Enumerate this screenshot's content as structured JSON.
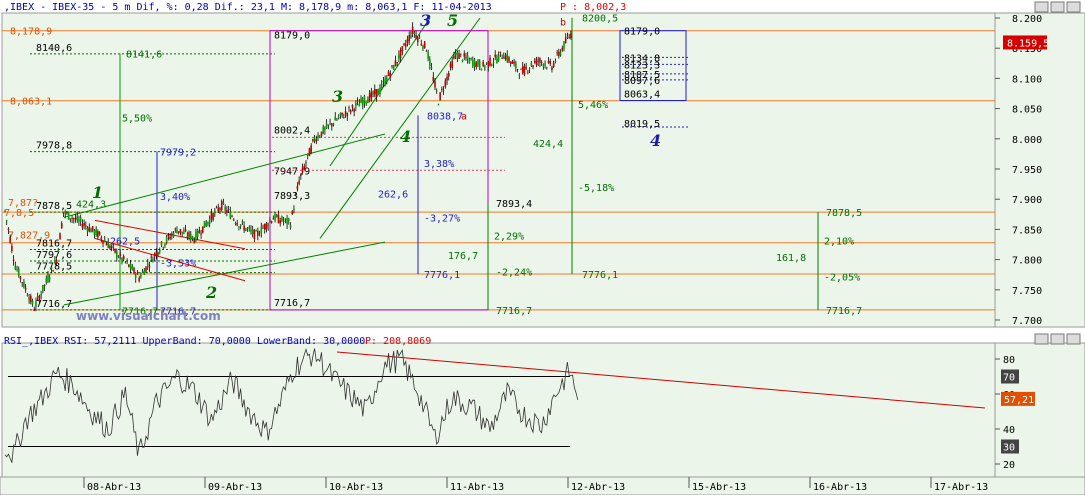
{
  "header": {
    "symbol_line": ",IBEX - IBEX-35 - 5 m Dif, %: 0,28 Dif.: 23,1 M: 8,178,9 m: 8,063,1 F: 11-04-2013",
    "pclose": "P : 8,002,3"
  },
  "rsi_header": {
    "text": "RSI_,IBEX RSI: 57,2111 UpperBand: 70,0000 LowerBand: 30,0000",
    "p": "P: 208,8069"
  },
  "watermark": "www.visualchart.com",
  "price_axis": {
    "ticks": [
      "8.200",
      "8.150",
      "8.100",
      "8.050",
      "8.000",
      "7.950",
      "7.900",
      "7.850",
      "7.800",
      "7.750",
      "7.700"
    ],
    "last_price": "8.159,5",
    "last_price_color": "#d50000"
  },
  "rsi_axis": {
    "ticks": [
      "80",
      "60",
      "40",
      "20"
    ],
    "upper_box": "70",
    "lower_box": "30",
    "current_box": "57,21"
  },
  "date_axis": [
    "08-Abr-13",
    "09-Abr-13",
    "10-Abr-13",
    "11-Abr-13",
    "12-Abr-13",
    "15-Abr-13",
    "16-Abr-13",
    "17-Abr-13"
  ],
  "annotations": {
    "h_left": [
      "8,178,9",
      "8,063,1",
      "7,87?",
      "7,827,9",
      "7,8,5"
    ],
    "box_left": [
      "8140,6",
      "7978,8",
      "7878,5",
      "7816,7",
      "7797,6",
      "7778,5",
      "7716,7"
    ],
    "left_fib": [
      "8141,6",
      "5,50%",
      "7979,2",
      "3,40%",
      "424,3",
      "262,5",
      "-3,53%",
      "7716,7",
      "7716,7"
    ],
    "mid_labels": [
      "8179,0",
      "8002,4",
      "7947,9",
      "7893,3",
      "262,6",
      "7716,7",
      "8038,7",
      "3,38%",
      "-3,27%",
      "7776,1",
      "7893,4",
      "2,29%",
      "176,7",
      "-2,24%",
      "7716,7"
    ],
    "right_labels": [
      "8200,5",
      "b",
      "a",
      "5,46%",
      "424,4",
      "-5,18%",
      "7776,1",
      "8179,0",
      "8134,8",
      "8123,3",
      "8107,5",
      "8097,6",
      "8063,4",
      "8019,5",
      "7878,5",
      "2,10%",
      "161,8",
      "-2,05%",
      "7716,7"
    ],
    "waves": [
      "1",
      "2",
      "3",
      "4",
      "3",
      "5",
      "4"
    ]
  },
  "chart_data": {
    "type": "candlestick",
    "title": "IBEX-35 5 m",
    "price_range": [
      7700,
      8200
    ],
    "rsi_range": [
      15,
      85
    ],
    "key_levels": [
      8178.9,
      8063.1,
      7878.5,
      7827.9,
      7776.1,
      7716.7
    ],
    "price_path": [
      [
        7880,
        0
      ],
      [
        7790,
        6
      ],
      [
        7720,
        17
      ],
      [
        7800,
        30
      ],
      [
        7878,
        34
      ],
      [
        7860,
        45
      ],
      [
        7840,
        55
      ],
      [
        7810,
        65
      ],
      [
        7790,
        72
      ],
      [
        7770,
        78
      ],
      [
        7820,
        90
      ],
      [
        7850,
        100
      ],
      [
        7835,
        110
      ],
      [
        7870,
        120
      ],
      [
        7890,
        126
      ],
      [
        7860,
        136
      ],
      [
        7840,
        146
      ],
      [
        7870,
        156
      ],
      [
        7860,
        166
      ],
      [
        7930,
        171
      ],
      [
        8000,
        180
      ],
      [
        8030,
        192
      ],
      [
        8060,
        207
      ],
      [
        8080,
        218
      ],
      [
        8140,
        230
      ],
      [
        8179,
        237
      ],
      [
        8150,
        245
      ],
      [
        8063,
        252
      ],
      [
        8140,
        262
      ],
      [
        8120,
        278
      ],
      [
        8140,
        290
      ],
      [
        8110,
        300
      ],
      [
        8130,
        310
      ],
      [
        8120,
        318
      ],
      [
        8155,
        325
      ],
      [
        8178,
        330
      ]
    ],
    "rsi_series": [
      [
        30,
        0
      ],
      [
        25,
        5
      ],
      [
        45,
        12
      ],
      [
        58,
        22
      ],
      [
        72,
        30
      ],
      [
        65,
        40
      ],
      [
        50,
        50
      ],
      [
        40,
        60
      ],
      [
        60,
        70
      ],
      [
        25,
        78
      ],
      [
        55,
        88
      ],
      [
        70,
        100
      ],
      [
        62,
        110
      ],
      [
        45,
        120
      ],
      [
        68,
        132
      ],
      [
        50,
        142
      ],
      [
        38,
        152
      ],
      [
        55,
        160
      ],
      [
        75,
        168
      ],
      [
        84,
        180
      ],
      [
        70,
        190
      ],
      [
        60,
        200
      ],
      [
        50,
        210
      ],
      [
        76,
        220
      ],
      [
        80,
        230
      ],
      [
        62,
        240
      ],
      [
        35,
        250
      ],
      [
        58,
        260
      ],
      [
        52,
        272
      ],
      [
        40,
        282
      ],
      [
        60,
        292
      ],
      [
        48,
        302
      ],
      [
        42,
        312
      ],
      [
        60,
        320
      ],
      [
        73,
        328
      ],
      [
        57,
        334
      ]
    ]
  }
}
